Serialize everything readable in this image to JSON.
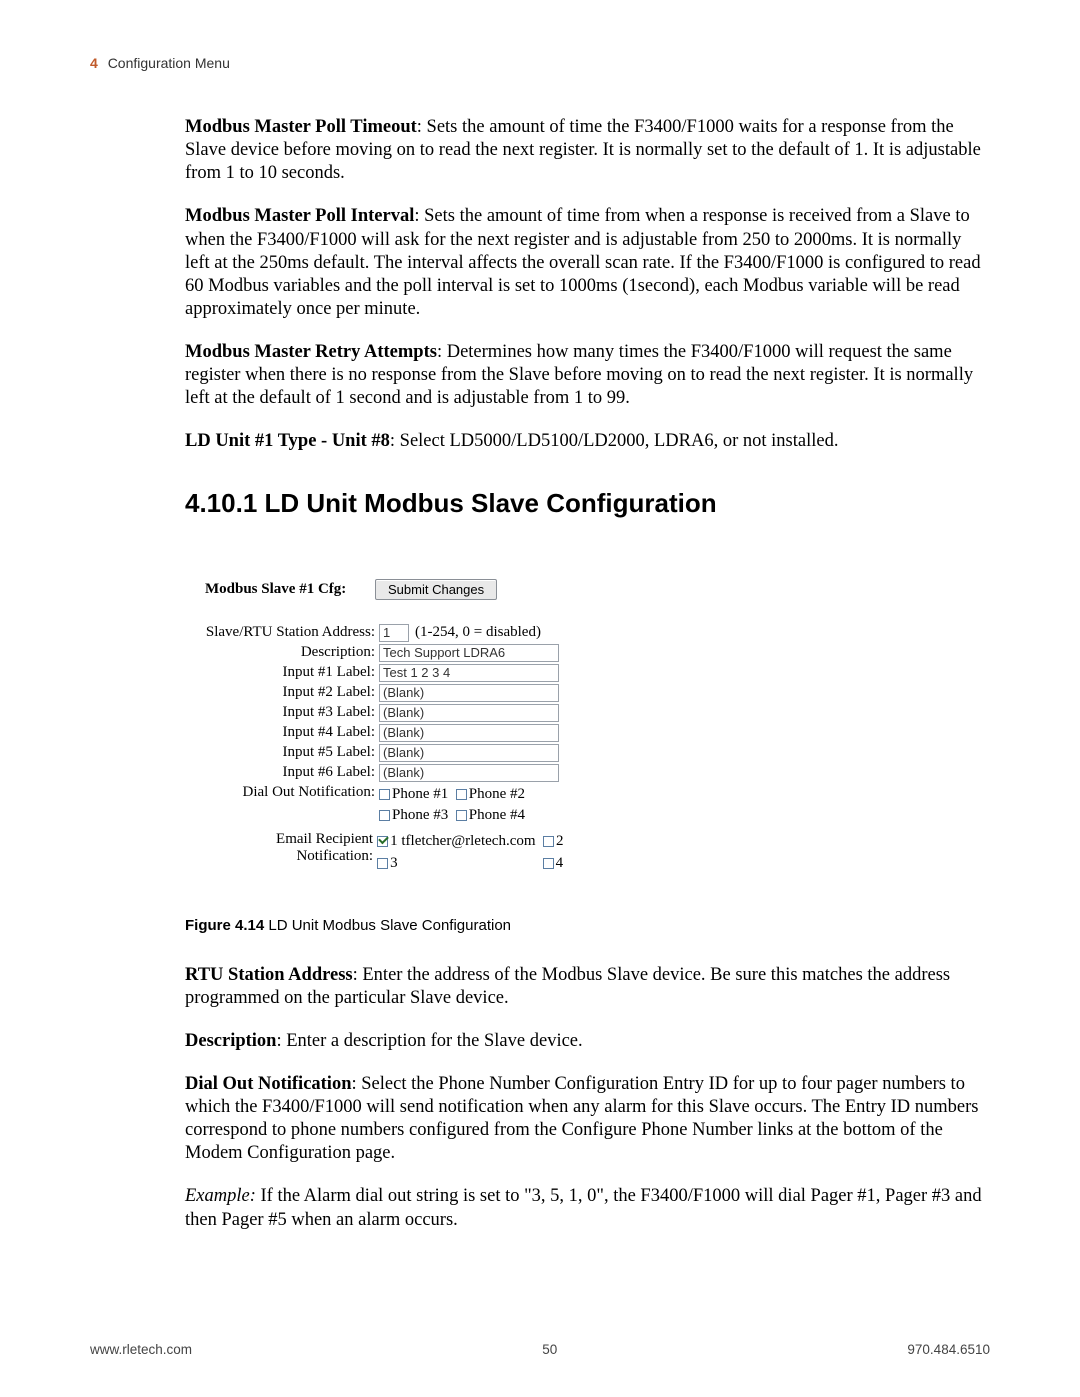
{
  "header": {
    "chapter_num": "4",
    "chapter_title": "Configuration Menu"
  },
  "paragraphs": {
    "p1": {
      "lead": "Modbus Master Poll Timeout",
      "text": ": Sets the amount of time the F3400/F1000 waits for a response from the Slave device before moving on to read the next register. It is normally set to the default of 1. It is adjustable from 1 to 10 seconds."
    },
    "p2": {
      "lead": "Modbus Master Poll Interval",
      "text": ": Sets the amount of time from when a response is received from a Slave to when the F3400/F1000 will ask for the next register and is adjustable from 250 to 2000ms. It is normally left at the 250ms default. The interval affects the overall scan rate. If the F3400/F1000 is configured to read 60 Modbus variables and the poll interval is set to 1000ms (1second), each Modbus variable will be read approximately once per minute."
    },
    "p3": {
      "lead": "Modbus Master Retry Attempts",
      "text": ": Determines how many times the F3400/F1000 will request the same register when there is no response from the Slave before moving on to read the next register. It is normally left at the default of 1 second and is adjustable from 1 to 99."
    },
    "p4": {
      "lead": "LD Unit #1 Type - Unit #8",
      "text": ": Select LD5000/LD5100/LD2000, LDRA6, or not installed."
    }
  },
  "section_heading": "4.10.1 LD Unit Modbus Slave Configuration",
  "form": {
    "title": "Modbus Slave #1 Cfg:",
    "submit_label": "Submit Changes",
    "rows": {
      "addr_label": "Slave/RTU Station Address:",
      "addr_value": "1",
      "addr_hint": "(1-254, 0 = disabled)",
      "desc_label": "Description:",
      "desc_value": "Tech Support LDRA6",
      "i1_label": "Input #1 Label:",
      "i1_value": "Test 1 2 3 4",
      "i2_label": "Input #2 Label:",
      "i2_value": "(Blank)",
      "i3_label": "Input #3 Label:",
      "i3_value": "(Blank)",
      "i4_label": "Input #4 Label:",
      "i4_value": "(Blank)",
      "i5_label": "Input #5 Label:",
      "i5_value": "(Blank)",
      "i6_label": "Input #6 Label:",
      "i6_value": "(Blank)",
      "dial_label": "Dial Out Notification:",
      "dial_p1": "Phone #1",
      "dial_p2": "Phone #2",
      "dial_p3": "Phone #3",
      "dial_p4": "Phone #4",
      "email_label": "Email Recipient Notification:",
      "email_1": "1 tfletcher@rletech.com",
      "email_2": "2",
      "email_3": "3",
      "email_4": "4"
    }
  },
  "figure_caption": {
    "lead": "Figure 4.14",
    "text": " LD Unit Modbus Slave Configuration"
  },
  "body2": {
    "b1": {
      "lead": "RTU Station Address",
      "text": ": Enter the address of the Modbus Slave device. Be sure this matches the address programmed on the particular Slave device."
    },
    "b2": {
      "lead": "Description",
      "text": ": Enter a description for the Slave device."
    },
    "b3": {
      "lead": "Dial Out Notification",
      "text": ": Select the Phone Number Configuration Entry ID for up to four pager numbers to which the F3400/F1000 will send notification when any alarm for this Slave occurs. The Entry ID numbers correspond to phone numbers configured from the Configure Phone Number links at the bottom of the Modem Configuration page."
    },
    "b4": {
      "lead_i": "Example:",
      "text": " If the Alarm dial out string is set to \"3, 5, 1, 0\", the F3400/F1000 will dial Pager #1, Pager #3 and then Pager #5 when an alarm occurs."
    }
  },
  "footer": {
    "left": "www.rletech.com",
    "center": "50",
    "right": "970.484.6510"
  }
}
